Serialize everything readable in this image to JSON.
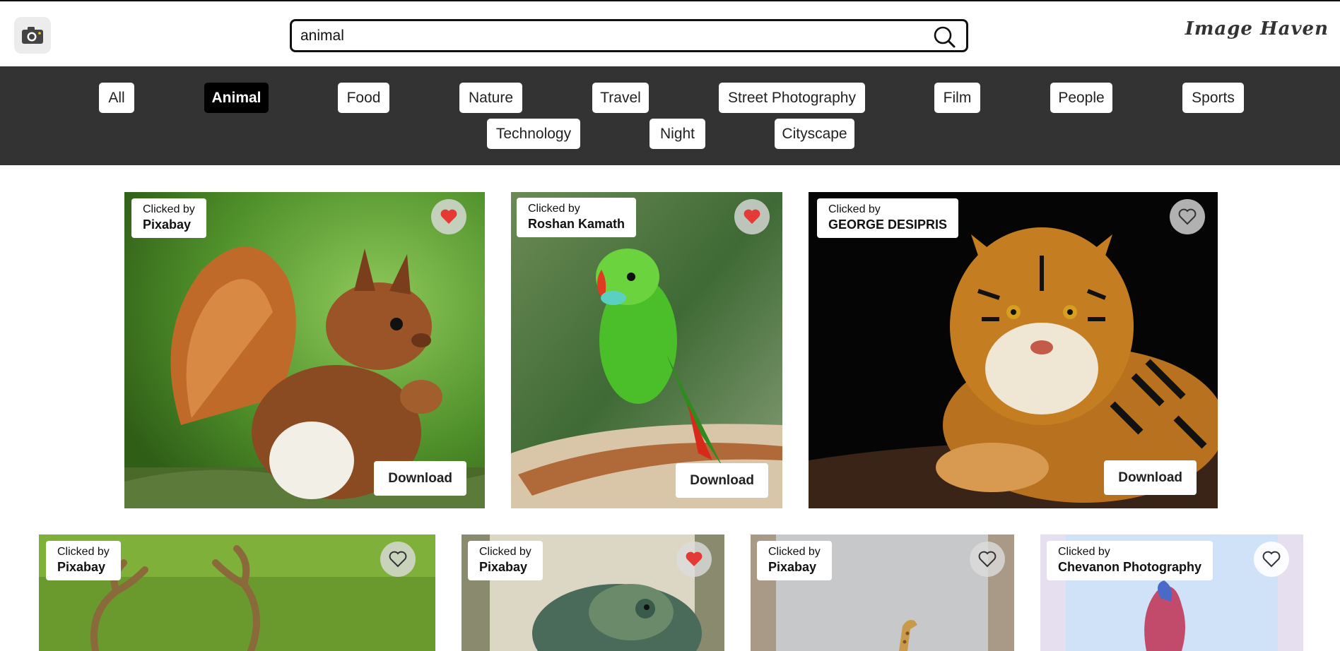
{
  "header": {
    "logo_icon": "camera-icon",
    "search": {
      "value": "animal",
      "placeholder": ""
    },
    "search_icon": "magnifier-icon",
    "brand": "Image Haven"
  },
  "categories": {
    "active": "Animal",
    "items": [
      "All",
      "Animal",
      "Food",
      "Nature",
      "Travel",
      "Street Photography",
      "Film",
      "People",
      "Sports",
      "Technology",
      "Night",
      "Cityscape"
    ]
  },
  "gallery": {
    "credit_prefix": "Clicked by",
    "download_label": "Download",
    "cards": [
      {
        "subject": "squirrel",
        "photographer": "Pixabay",
        "liked": true
      },
      {
        "subject": "parrot",
        "photographer": "Roshan Kamath",
        "liked": true
      },
      {
        "subject": "tiger",
        "photographer": "GEORGE DESIPRIS",
        "liked": false
      },
      {
        "subject": "deer",
        "photographer": "Pixabay",
        "liked": false
      },
      {
        "subject": "chameleon",
        "photographer": "Pixabay",
        "liked": true
      },
      {
        "subject": "giraffe",
        "photographer": "Pixabay",
        "liked": false
      },
      {
        "subject": "betta-fish",
        "photographer": "Chevanon Photography",
        "liked": false
      }
    ]
  },
  "colors": {
    "like_red": "#e53935",
    "bar_bg": "#333333",
    "active_chip": "#000000"
  }
}
